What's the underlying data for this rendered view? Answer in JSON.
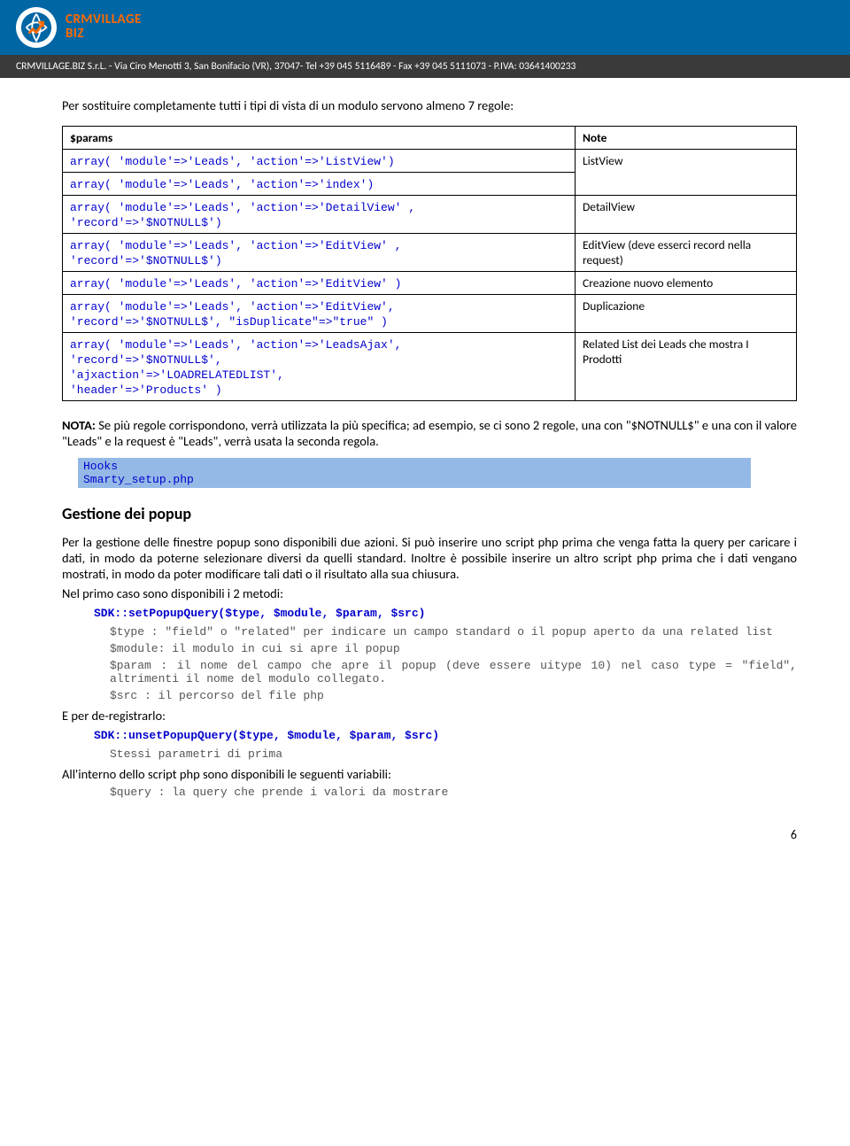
{
  "header": {
    "brand_line1": "CRMVILLAGE",
    "brand_line2": "BIZ",
    "address": "CRMVILLAGE.BIZ S.r.L. - Via Ciro Menotti 3, San Bonifacio (VR), 37047- Tel +39 045 5116489 - Fax +39 045 5111073 - P.IVA: 03641400233"
  },
  "intro": "Per sostituire completamente tutti i tipi di vista di un modulo servono almeno 7 regole:",
  "table": {
    "head_params": "$params",
    "head_note": "Note",
    "rows": [
      {
        "param": "array( 'module'=>'Leads', 'action'=>'ListView')",
        "note": "ListView"
      },
      {
        "param": "array( 'module'=>'Leads', 'action'=>'index')",
        "note": ""
      },
      {
        "param": "array( 'module'=>'Leads', 'action'=>'DetailView' ,\n'record'=>'$NOTNULL$')",
        "note": "DetailView"
      },
      {
        "param": "array( 'module'=>'Leads', 'action'=>'EditView' ,\n'record'=>'$NOTNULL$')",
        "note": "EditView (deve esserci record nella request)"
      },
      {
        "param": "array( 'module'=>'Leads', 'action'=>'EditView' )",
        "note": "Creazione nuovo elemento"
      },
      {
        "param": "array( 'module'=>'Leads', 'action'=>'EditView',\n'record'=>'$NOTNULL$', \"isDuplicate\"=>\"true\" )",
        "note": "Duplicazione"
      },
      {
        "param": "array( 'module'=>'Leads', 'action'=>'LeadsAjax',\n'record'=>'$NOTNULL$',\n'ajxaction'=>'LOADRELATEDLIST',\n'header'=>'Products' )",
        "note": "Related List dei Leads che mostra I Prodotti"
      }
    ]
  },
  "nota_label": "NOTA:",
  "nota_text": " Se più regole corrispondono, verrà utilizzata la più specifica; ad esempio, se ci sono 2 regole, una con \"$NOTNULL$\" e una con il valore \"Leads\" e la request è \"Leads\", verrà usata la seconda regola.",
  "hooks_block": "Hooks\nSmarty_setup.php",
  "popup": {
    "title": "Gestione dei popup",
    "p1": "Per la gestione delle finestre popup sono disponibili due azioni. Si può inserire uno script php prima che venga fatta la query per caricare i dati, in modo da poterne selezionare diversi da quelli standard. Inoltre è possibile inserire un altro script php prima che i dati vengano mostrati, in modo da poter modificare tali dati o il risultato alla sua chiusura.",
    "p2": "Nel primo caso sono disponibili i 2 metodi:",
    "call_set": "SDK::setPopupQuery($type, $module, $param, $src)",
    "type_desc": "$type  : \"field\" o \"related\" per indicare un campo standard o il popup aperto da una related list",
    "module_desc": "$module: il modulo in cui si apre il popup",
    "param_desc": "$param : il nome del campo che apre il popup (deve essere uitype 10) nel caso type  = \"field\", altrimenti il nome del modulo collegato.",
    "src_desc": "$src   : il percorso del file php",
    "dereg": "E per de-registrarlo:",
    "call_unset": "SDK::unsetPopupQuery($type, $module, $param, $src)",
    "same_params": "Stessi parametri di prima",
    "p3": "All'interno dello script php sono disponibili le seguenti variabili:",
    "query_desc": "$query : la query che prende i valori da mostrare"
  },
  "page_number": "6"
}
